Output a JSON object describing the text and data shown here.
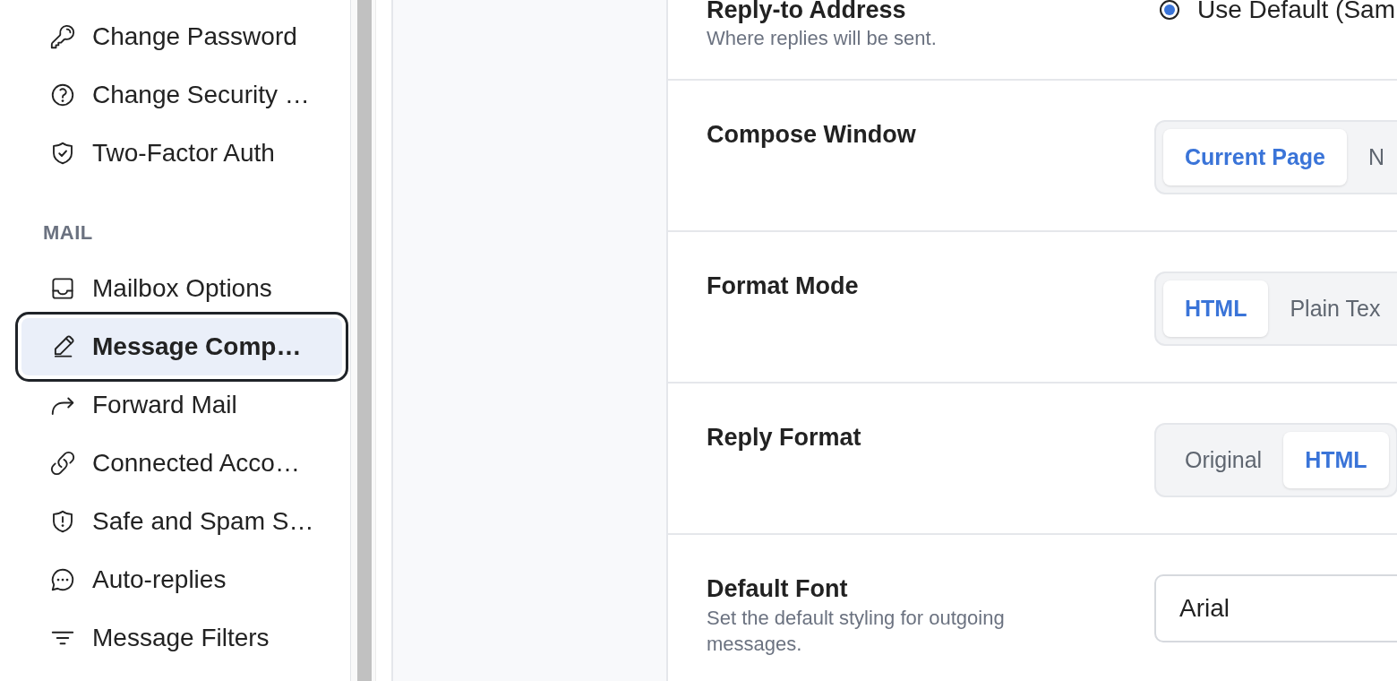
{
  "sidebar": {
    "sections": [
      {
        "items": [
          {
            "label": "Change Password",
            "selected": false,
            "focused": false
          },
          {
            "label": "Change Security …",
            "selected": false,
            "focused": false
          },
          {
            "label": "Two-Factor Auth",
            "selected": false,
            "focused": false
          }
        ]
      },
      {
        "title": "MAIL",
        "items": [
          {
            "label": "Mailbox Options",
            "selected": false,
            "focused": false
          },
          {
            "label": "Message Comp…",
            "selected": true,
            "focused": true
          },
          {
            "label": "Forward Mail",
            "selected": false,
            "focused": false
          },
          {
            "label": "Connected Acco…",
            "selected": false,
            "focused": false
          },
          {
            "label": "Safe and Spam S…",
            "selected": false,
            "focused": false
          },
          {
            "label": "Auto-replies",
            "selected": false,
            "focused": false
          },
          {
            "label": "Message Filters",
            "selected": false,
            "focused": false
          }
        ]
      }
    ]
  },
  "settings": [
    {
      "title": "Reply-to Address",
      "description": "Where replies will be sent.",
      "control": {
        "kind": "radio",
        "options": [
          {
            "label": "Use Default (Sam",
            "selected": true
          }
        ]
      }
    },
    {
      "title": "Compose Window",
      "control": {
        "kind": "segmented",
        "options": [
          {
            "label": "Current Page",
            "selected": true
          },
          {
            "label": "N",
            "selected": false
          }
        ]
      }
    },
    {
      "title": "Format Mode",
      "control": {
        "kind": "segmented",
        "options": [
          {
            "label": "HTML",
            "selected": true
          },
          {
            "label": "Plain Tex",
            "selected": false
          }
        ]
      }
    },
    {
      "title": "Reply Format",
      "control": {
        "kind": "segmented",
        "options": [
          {
            "label": "Original",
            "selected": false
          },
          {
            "label": "HTML",
            "selected": true
          }
        ]
      }
    },
    {
      "title": "Default Font",
      "description": "Set the default styling for outgoing messages.",
      "control": {
        "kind": "select",
        "value": "Arial"
      }
    }
  ]
}
